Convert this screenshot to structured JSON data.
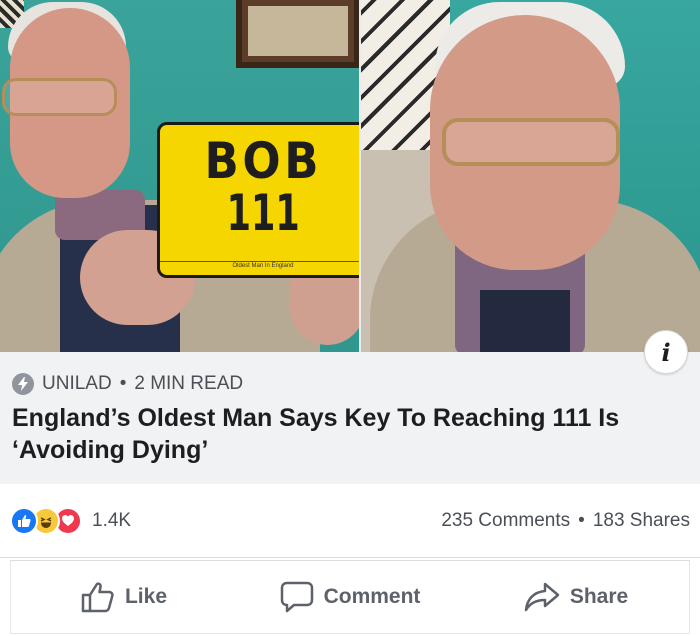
{
  "plate": {
    "line1": "BOB",
    "line2": "111",
    "caption": "Oldest Man In England"
  },
  "info_button": {
    "glyph": "i"
  },
  "link": {
    "source": "UNILAD",
    "separator": "•",
    "read_time": "2 MIN READ",
    "headline": "England’s Oldest Man Says Key To Reaching 111 Is ‘Avoiding Dying’"
  },
  "reactions": {
    "icons": [
      "like-icon",
      "haha-icon",
      "love-icon"
    ],
    "count": "1.4K",
    "comments": "235 Comments",
    "separator": "•",
    "shares": "183 Shares"
  },
  "actions": {
    "like": "Like",
    "comment": "Comment",
    "share": "Share"
  },
  "colors": {
    "like_blue": "#1877f2",
    "haha_yellow": "#f7c83a",
    "love_red": "#f0384e",
    "plate_yellow": "#f5d600",
    "wall_teal": "#35a097"
  }
}
